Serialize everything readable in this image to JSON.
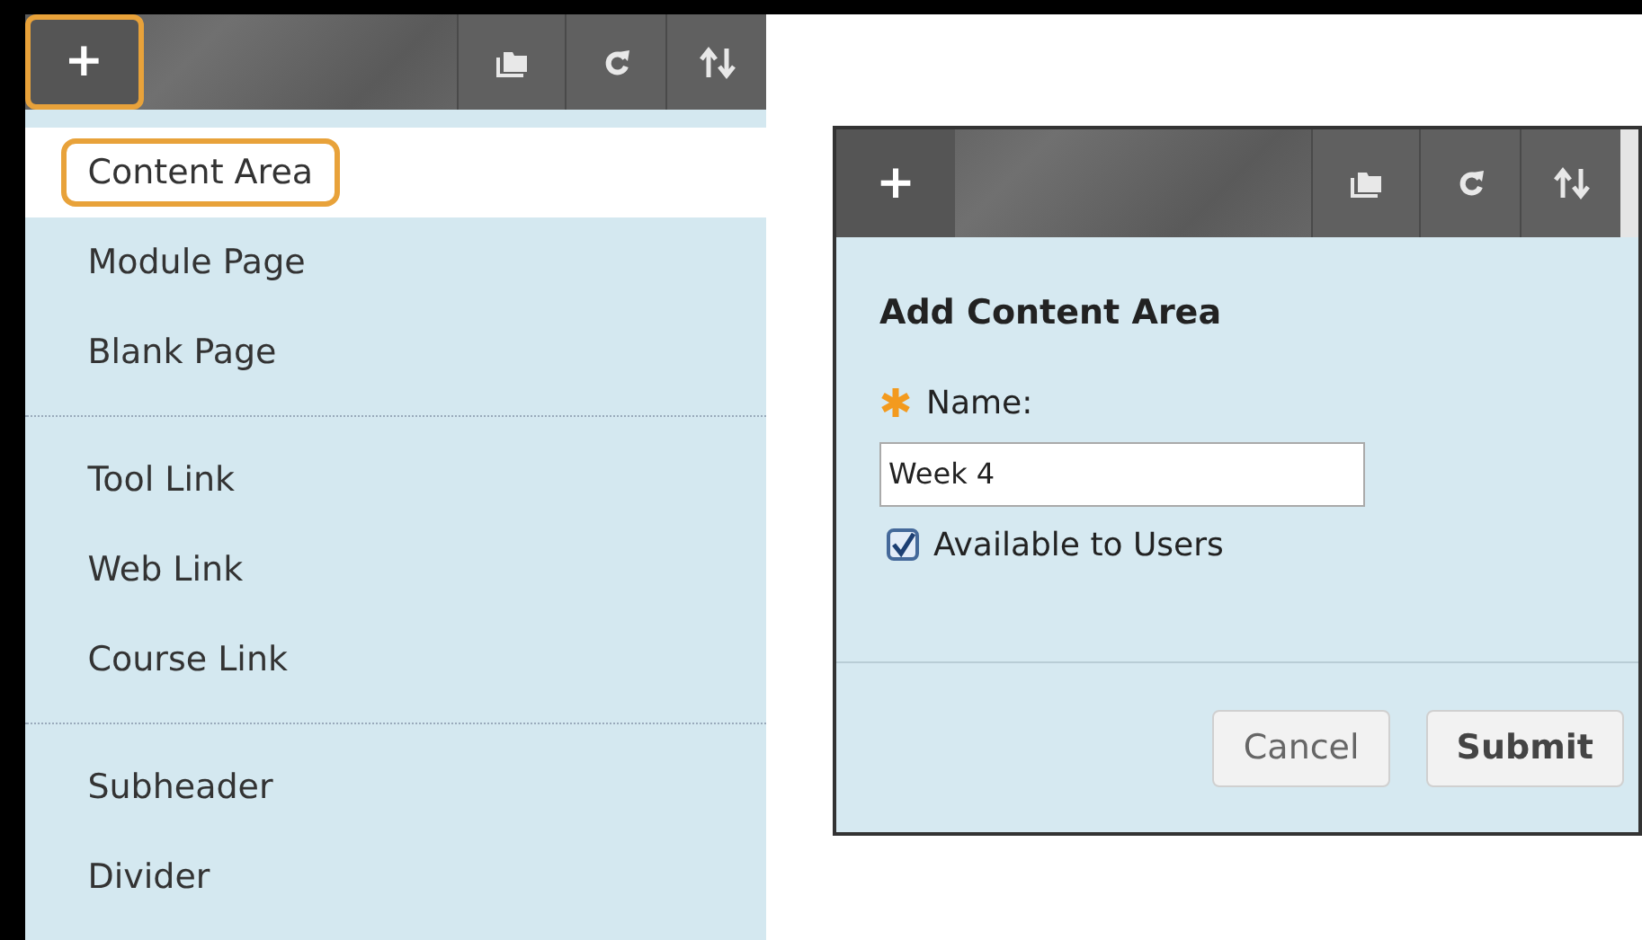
{
  "menu_toolbar": {
    "add_button": {
      "label": "+",
      "highlighted": true
    }
  },
  "menu": {
    "groups": [
      {
        "items": [
          {
            "label": "Content Area",
            "selected": true
          },
          {
            "label": "Module Page",
            "selected": false
          },
          {
            "label": "Blank Page",
            "selected": false
          }
        ]
      },
      {
        "items": [
          {
            "label": "Tool Link",
            "selected": false
          },
          {
            "label": "Web Link",
            "selected": false
          },
          {
            "label": "Course Link",
            "selected": false
          }
        ]
      },
      {
        "items": [
          {
            "label": "Subheader",
            "selected": false
          },
          {
            "label": "Divider",
            "selected": false
          }
        ]
      }
    ]
  },
  "dialog": {
    "toolbar": {
      "add_button": {
        "label": "+",
        "highlighted": false
      }
    },
    "title": "Add Content Area",
    "name_field": {
      "label": "Name:",
      "required": true,
      "value": "Week 4"
    },
    "available_checkbox": {
      "label": "Available to Users",
      "checked": true
    },
    "buttons": [
      {
        "label": "Cancel",
        "kind": "secondary"
      },
      {
        "label": "Submit",
        "kind": "primary"
      }
    ]
  }
}
